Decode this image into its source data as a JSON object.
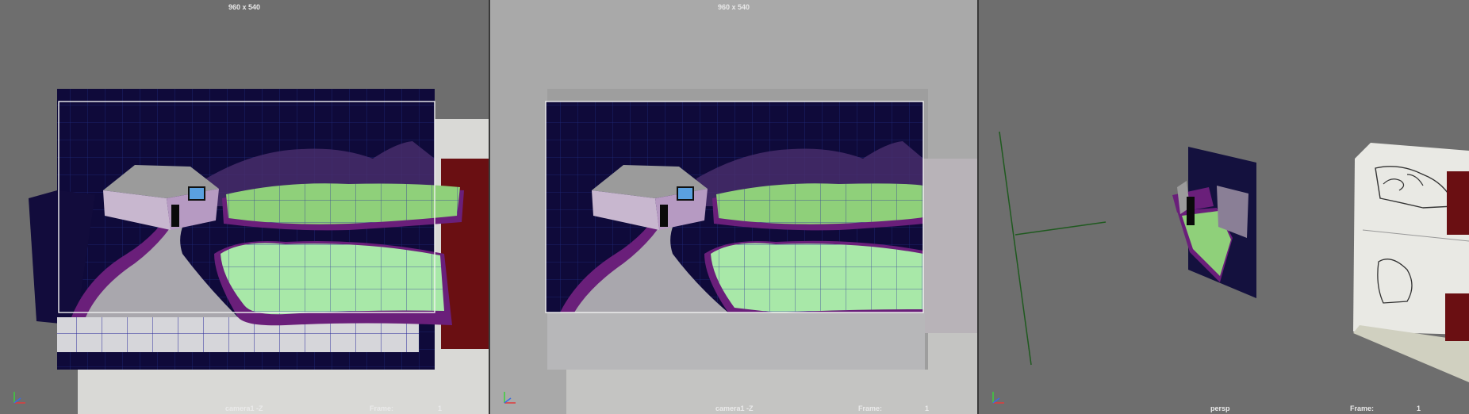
{
  "viewports": [
    {
      "resolution": "960 x 540",
      "camera": "camera1 -Z",
      "frame_label": "Frame:",
      "frame_value": "1"
    },
    {
      "resolution": "960 x 540",
      "camera": "camera1 -Z",
      "frame_label": "Frame:",
      "frame_value": "1"
    },
    {
      "resolution": "",
      "camera": "persp",
      "frame_label": "Frame:",
      "frame_value": "1"
    }
  ],
  "axis_icon": "xyz-axis-icon",
  "colors": {
    "viewport_bg": "#6e6e6e",
    "viewport_bg_xray": "#a9a9a9",
    "sky": "#0f0a3a",
    "wire": "#1b1a8a",
    "lawn": "#8fd07a",
    "purple": "#6a1f7a",
    "red_card": "#6a0f12"
  }
}
